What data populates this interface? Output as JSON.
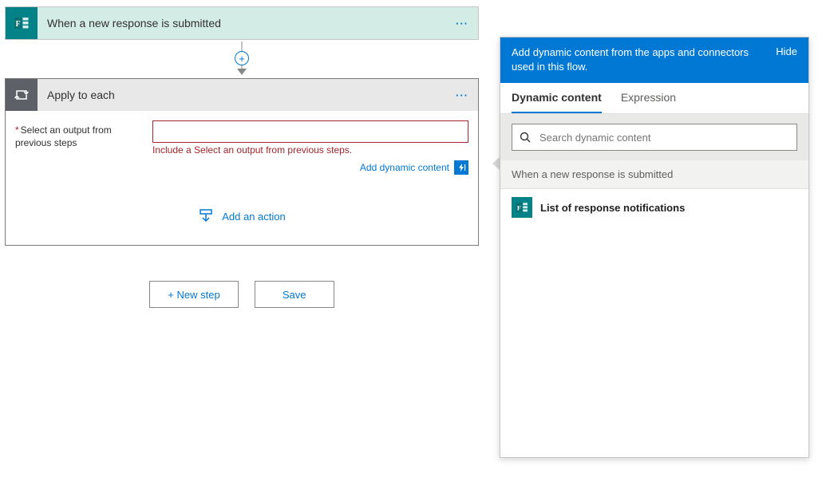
{
  "trigger": {
    "title": "When a new response is submitted",
    "menu": "···"
  },
  "connector": {
    "plus": "+"
  },
  "applyToEach": {
    "title": "Apply to each",
    "menu": "···",
    "field": {
      "asterisk": "*",
      "label": "Select an output from previous steps",
      "value": "",
      "error": "Include a Select an output from previous steps."
    },
    "addDynamicContent": "Add dynamic content",
    "addAction": "Add an action"
  },
  "footer": {
    "newStep": "+ New step",
    "save": "Save"
  },
  "panel": {
    "headerText": "Add dynamic content from the apps and connectors used in this flow.",
    "hide": "Hide",
    "tabs": {
      "dynamic": "Dynamic content",
      "expression": "Expression"
    },
    "searchPlaceholder": "Search dynamic content",
    "group": {
      "title": "When a new response is submitted",
      "item": "List of response notifications"
    }
  }
}
